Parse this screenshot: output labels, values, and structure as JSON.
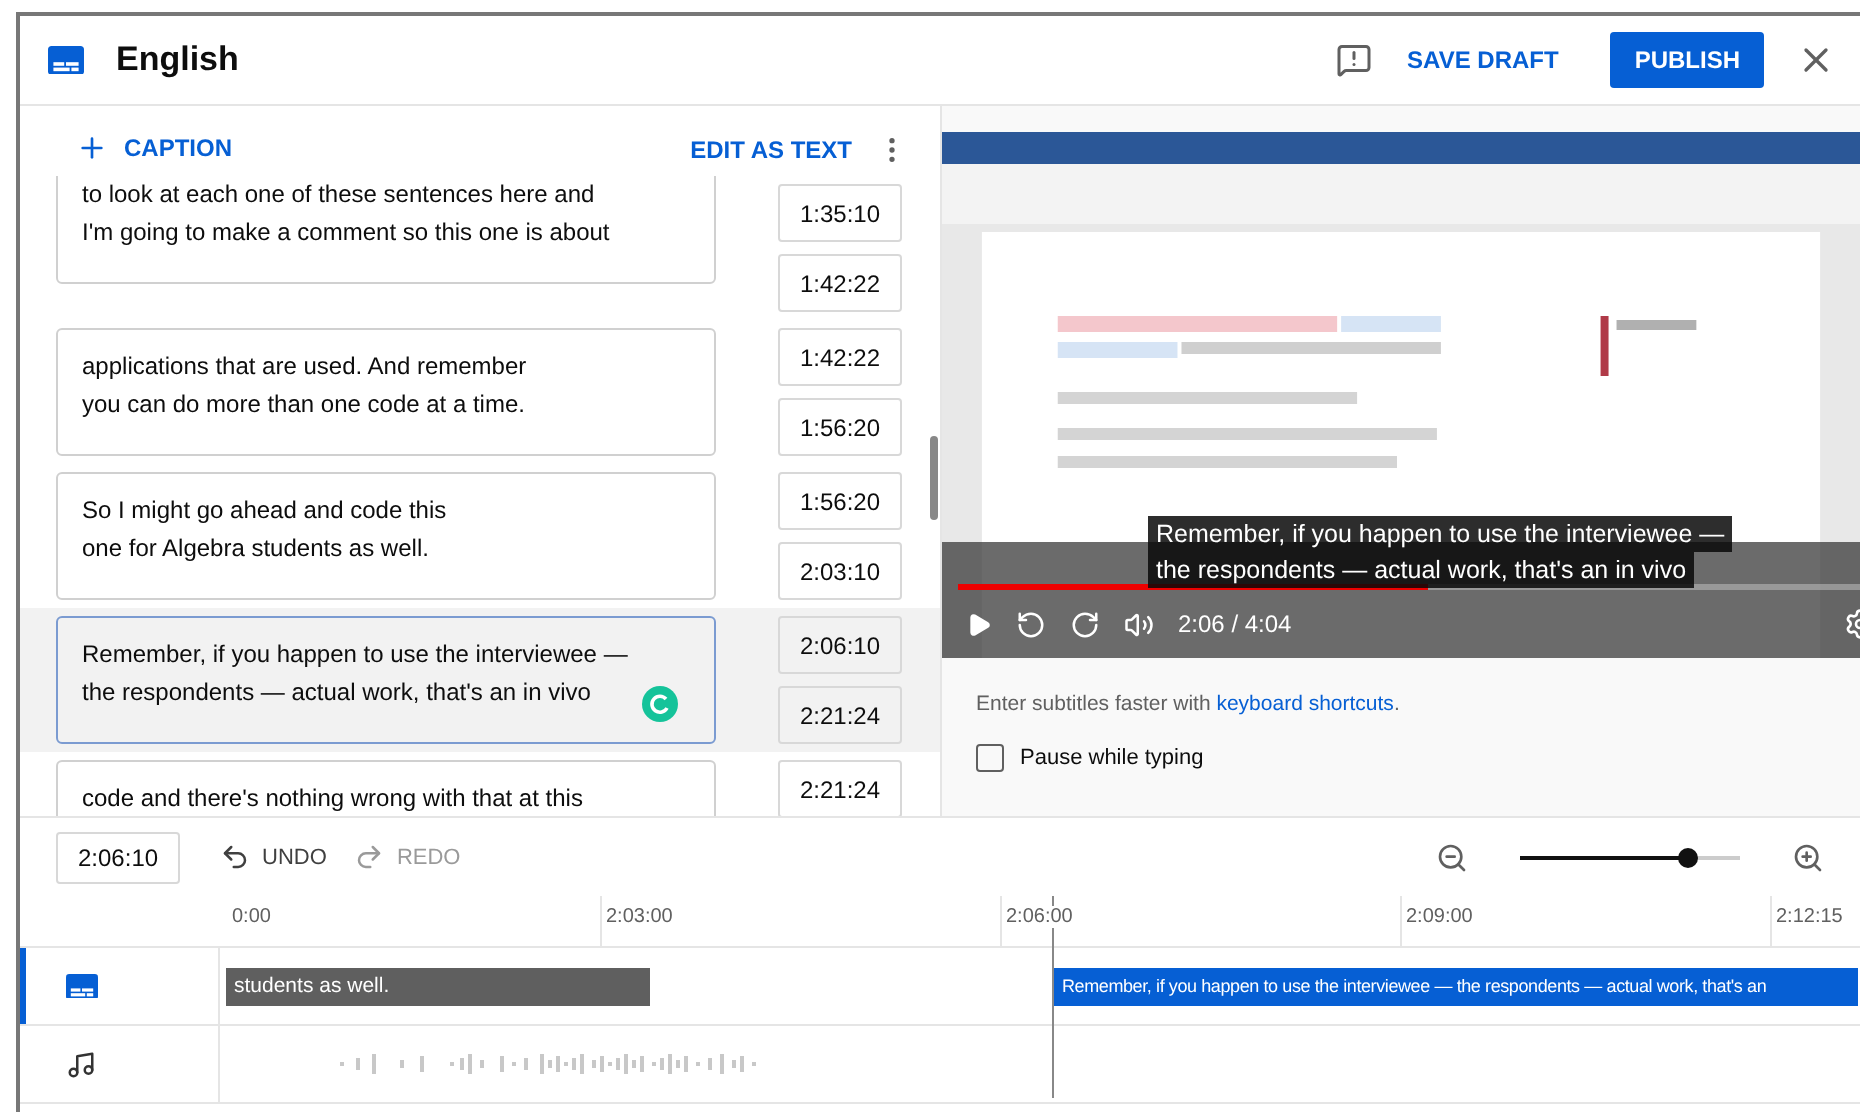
{
  "header": {
    "title": "English",
    "save_draft": "SAVE DRAFT",
    "publish": "PUBLISH"
  },
  "caption_toolbar": {
    "add_label": "CAPTION",
    "edit_label": "EDIT AS TEXT"
  },
  "captions": [
    {
      "lines": [
        "to look at each one of these sentences here and",
        "I'm going to make a comment so this one is about"
      ],
      "start": "1:35:10",
      "end": "1:42:22",
      "selected": false
    },
    {
      "lines": [
        "applications that are used. And remember",
        "you can do more than one code at a time."
      ],
      "start": "1:42:22",
      "end": "1:56:20",
      "selected": false
    },
    {
      "lines": [
        "So I might go ahead and code this",
        "one for Algebra students as well."
      ],
      "start": "1:56:20",
      "end": "2:03:10",
      "selected": false
    },
    {
      "lines": [
        "Remember, if you happen to use the interviewee —",
        "the respondents — actual work, that's an in vivo"
      ],
      "start": "2:06:10",
      "end": "2:21:24",
      "selected": true
    },
    {
      "lines": [
        "code and there's nothing wrong with that at this"
      ],
      "start": "2:21:24",
      "selected": false
    }
  ],
  "video": {
    "kind": "picture",
    "caption_lines": [
      "Remember, if you happen to use the interviewee —",
      "the respondents — actual work, that's an in vivo"
    ],
    "time": "2:06 / 4:04",
    "progress": {
      "level": 0.52
    }
  },
  "helper": {
    "text": "Enter subtitles faster with ",
    "link": "keyboard shortcuts",
    "suffix": "."
  },
  "pause_checkbox": {
    "label": "Pause while typing",
    "checked": false
  },
  "timeline": {
    "current_time": "2:06:10",
    "undo": {
      "label": "UNDO",
      "disabled": false
    },
    "redo": {
      "label": "REDO",
      "disabled": true
    },
    "zoom": {
      "level": 0.76
    },
    "ruler": [
      "0:00",
      "2:03:00",
      "2:06:00",
      "2:09:00",
      "2:12:15"
    ],
    "caption_track": [
      {
        "text": "students as well.",
        "selected": false
      },
      {
        "text": "Remember, if you happen to use the interviewee — the respondents — actual work, that's an",
        "selected": true
      }
    ]
  }
}
